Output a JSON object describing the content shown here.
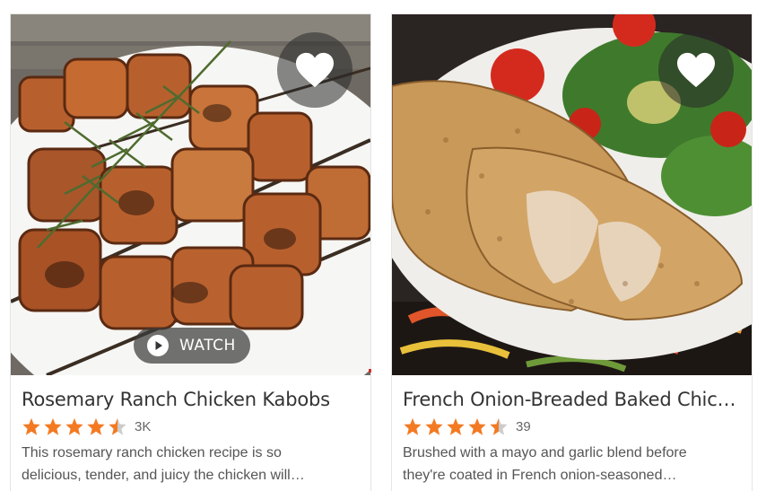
{
  "colors": {
    "star": "#f37a22",
    "star_empty": "#cccccc",
    "overlay": "rgba(40,40,40,0.55)"
  },
  "cards": [
    {
      "title": "Rosemary Ranch Chicken Kabobs",
      "rating": 4.5,
      "rating_count": "3K",
      "description_line1": "This rosemary ranch chicken recipe is so",
      "description_line2": "delicious, tender, and juicy the chicken will…",
      "watch_label": "WATCH",
      "favorite_icon": "heart-icon"
    },
    {
      "title": "French Onion-Breaded Baked Chic…",
      "rating": 4.5,
      "rating_count": "39",
      "description_line1": "Brushed with a mayo and garlic blend before",
      "description_line2": "they're coated in French onion-seasoned…",
      "favorite_icon": "heart-icon"
    }
  ]
}
